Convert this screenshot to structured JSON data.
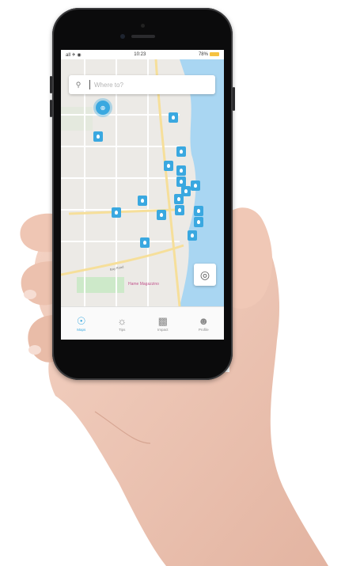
{
  "status": {
    "left": "all ✈ ◉",
    "time": "10:23",
    "battery": "78%"
  },
  "search": {
    "placeholder": "Where to?"
  },
  "map": {
    "place_label": "Hame Magazzino",
    "street_label": "Bay Road"
  },
  "tabs": [
    {
      "label": "Maps",
      "icon": "map-pin-icon",
      "active": true
    },
    {
      "label": "Tips",
      "icon": "lightbulb-icon",
      "active": false
    },
    {
      "label": "Impact",
      "icon": "chart-icon",
      "active": false
    },
    {
      "label": "Profile",
      "icon": "user-icon",
      "active": false
    }
  ],
  "colors": {
    "accent": "#3aa8e0",
    "water": "#a9d6f2",
    "park": "#cde9c9",
    "road_major": "#f6df9a"
  }
}
